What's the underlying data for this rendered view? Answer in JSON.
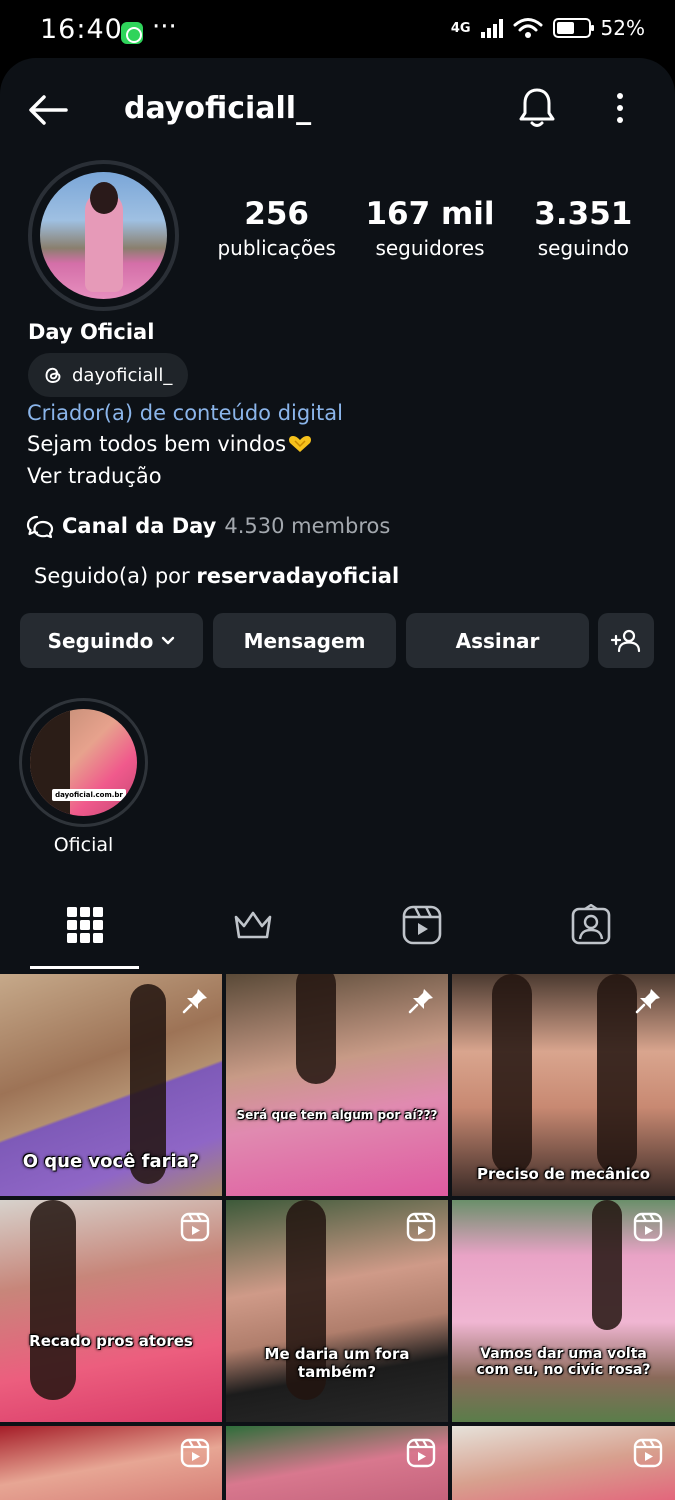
{
  "status_bar": {
    "time": "16:40",
    "dots": "···",
    "network": "4G",
    "battery": "52%"
  },
  "header": {
    "username": "dayoficiall_"
  },
  "profile": {
    "stats": [
      {
        "value": "256",
        "label": "publicações"
      },
      {
        "value": "167 mil",
        "label": "seguidores"
      },
      {
        "value": "3.351",
        "label": "seguindo"
      }
    ],
    "full_name": "Day Oficial",
    "threads_handle": "dayoficiall_",
    "category": "Criador(a) de conteúdo digital",
    "bio": "Sejam todos bem vindos",
    "translate": "Ver tradução",
    "channel_name": "Canal da Day",
    "channel_members": "4.530 membros",
    "followed_by_prefix": "Seguido(a) por",
    "followed_by_user": "reservadayoficial"
  },
  "actions": {
    "following": "Seguindo",
    "message": "Mensagem",
    "subscribe": "Assinar"
  },
  "highlights": [
    {
      "label": "Oficial",
      "image_text": "dayoficial.com.br"
    }
  ],
  "grid": [
    {
      "caption": "O que você faria?",
      "badge": "pin-icon"
    },
    {
      "caption": "Será que tem algum por aí???",
      "badge": "pin-icon"
    },
    {
      "caption": "Preciso de mecânico",
      "badge": "pin-icon"
    },
    {
      "caption": "Recado pros atores",
      "badge": "reel-icon"
    },
    {
      "caption": "Me daria um fora também?",
      "badge": "reel-icon"
    },
    {
      "caption": "Vamos dar uma volta com eu, no civic rosa?",
      "badge": "reel-icon"
    },
    {
      "caption": "",
      "badge": "reel-icon"
    },
    {
      "caption": "",
      "badge": "reel-icon"
    },
    {
      "caption": "",
      "badge": "reel-icon"
    }
  ],
  "colors": {
    "background": "#0d1116",
    "button": "#262b31",
    "category_link": "#8bb5ea",
    "muted": "#a3a8ae"
  }
}
